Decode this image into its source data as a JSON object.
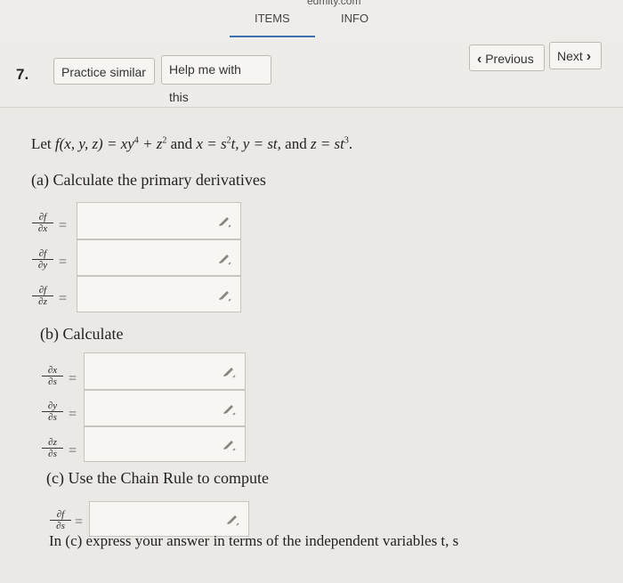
{
  "header": {
    "brand_fragment": "edmity.com",
    "tabs": [
      "ITEMS",
      "INFO"
    ]
  },
  "toolbar": {
    "question_number": "7.",
    "practice_label": "Practice similar",
    "help_label": "Help me with this",
    "previous_label": "Previous",
    "next_label": "Next",
    "previous_glyph": "‹",
    "next_glyph": "›"
  },
  "problem": {
    "statement_prefix": "Let ",
    "statement_func": "f(x, y, z) = xy",
    "statement_exp1": "4",
    "statement_plus": " + z",
    "statement_exp2": "2",
    "statement_and1": " and ",
    "statement_x": "x = s",
    "statement_exp3": "2",
    "statement_t": "t, y = st,",
    "statement_and2": " and ",
    "statement_z": "z = st",
    "statement_exp4": "3",
    "statement_end": ".",
    "part_a": "(a) Calculate the primary derivatives",
    "part_b": "(b) Calculate",
    "part_c": "(c) Use the Chain Rule to compute",
    "footer": "In (c) express your answer in terms of the independent variables t, s"
  },
  "derivatives_a": [
    {
      "num": "∂f",
      "den": "∂x"
    },
    {
      "num": "∂f",
      "den": "∂y"
    },
    {
      "num": "∂f",
      "den": "∂z"
    }
  ],
  "derivatives_b": [
    {
      "num": "∂x",
      "den": "∂s"
    },
    {
      "num": "∂y",
      "den": "∂s"
    },
    {
      "num": "∂z",
      "den": "∂s"
    }
  ],
  "derivative_c": {
    "num": "∂f",
    "den": "∂s"
  },
  "equals": "=",
  "icons": {
    "answer_box_tool": "pencil-icon"
  }
}
